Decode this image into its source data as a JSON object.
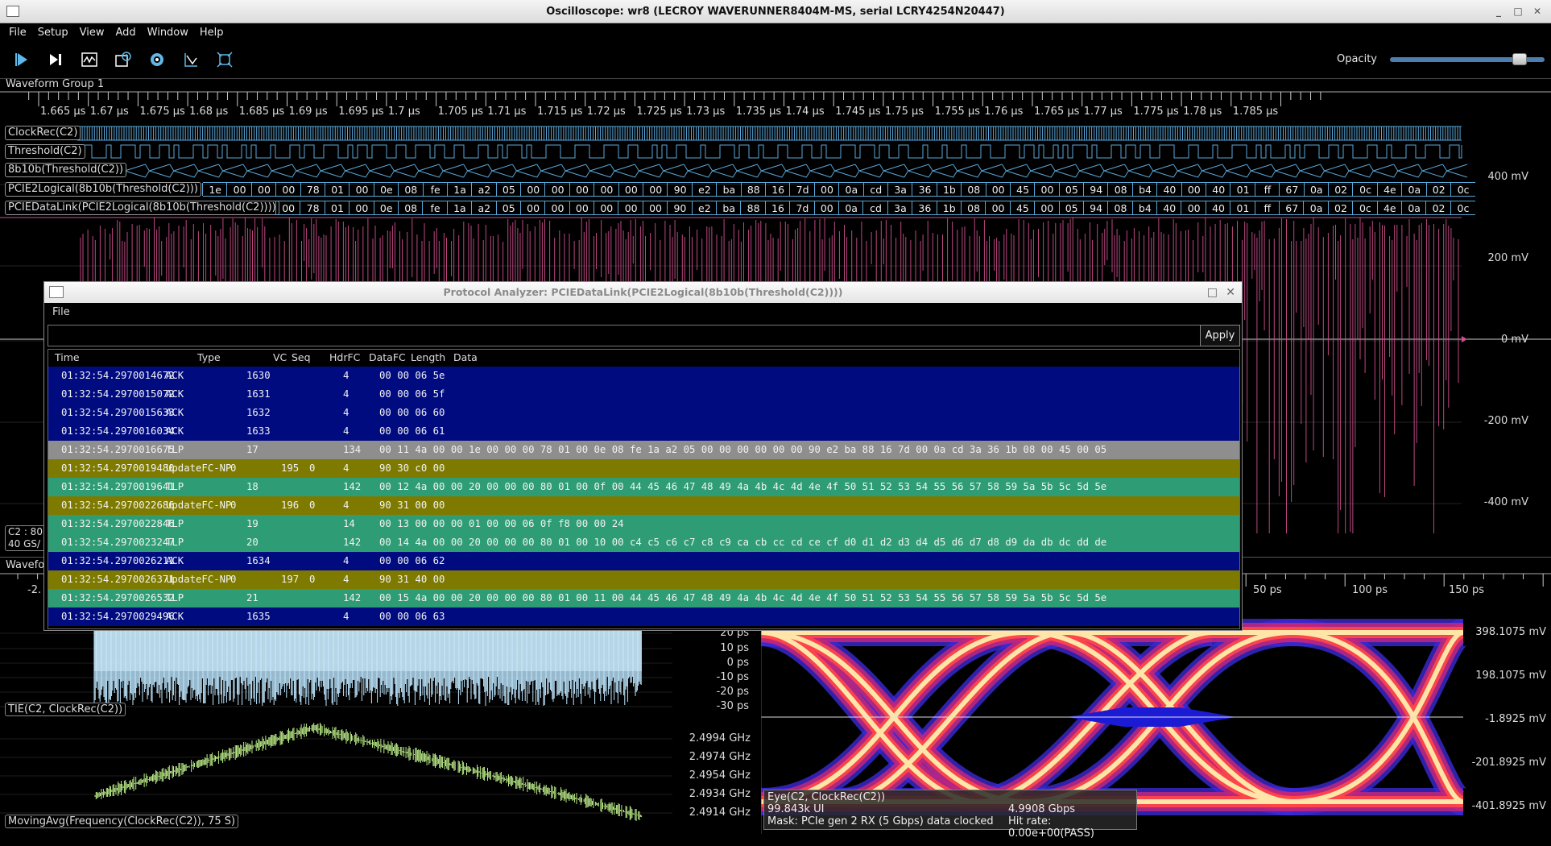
{
  "window": {
    "title": "Oscilloscope: wr8 (LECROY WAVERUNNER8404M-MS, serial LCRY4254N20447)",
    "controls": [
      "_",
      "□",
      "✕"
    ]
  },
  "menu": [
    "File",
    "Setup",
    "View",
    "Add",
    "Window",
    "Help"
  ],
  "toolbar": {
    "buttons": [
      "play-icon",
      "step-icon",
      "waveform-icon",
      "trigger-icon",
      "settings-icon",
      "measure-icon",
      "zoom-fit-icon"
    ],
    "opacity_label": "Opacity",
    "opacity_value": 0.84
  },
  "group1": {
    "label": "Waveform Group 1",
    "time_ticks": [
      "1.665 µs",
      "1.67 µs",
      "1.675 µs",
      "1.68 µs",
      "1.685 µs",
      "1.69 µs",
      "1.695 µs",
      "1.7 µs",
      "1.705 µs",
      "1.71 µs",
      "1.715 µs",
      "1.72 µs",
      "1.725 µs",
      "1.73 µs",
      "1.735 µs",
      "1.74 µs",
      "1.745 µs",
      "1.75 µs",
      "1.755 µs",
      "1.76 µs",
      "1.765 µs",
      "1.77 µs",
      "1.775 µs",
      "1.78 µs",
      "1.785 µs"
    ],
    "traces": [
      "ClockRec(C2)",
      "Threshold(C2)",
      "8b10b(Threshold(C2))",
      "PCIE2Logical(8b10b(Threshold(C2)))",
      "PCIEDataLink(PCIE2Logical(8b10b(Threshold(C2))))"
    ],
    "logical_bytes": [
      "1e",
      "00",
      "00",
      "00",
      "78",
      "01",
      "00",
      "0e",
      "08",
      "fe",
      "1a",
      "a2",
      "05",
      "00",
      "00",
      "00",
      "00",
      "00",
      "00",
      "90",
      "e2",
      "ba",
      "88",
      "16",
      "7d",
      "00",
      "0a",
      "cd",
      "3a",
      "36",
      "1b",
      "08",
      "00",
      "45",
      "00",
      "05",
      "94",
      "08",
      "b4",
      "40",
      "00",
      "40",
      "01",
      "ff",
      "67",
      "0a",
      "02",
      "0c",
      "4e",
      "0a",
      "02",
      "0c"
    ],
    "datalink_bytes": [
      "00",
      "78",
      "01",
      "00",
      "0e",
      "08",
      "fe",
      "1a",
      "a2",
      "05",
      "00",
      "00",
      "00",
      "00",
      "00",
      "00",
      "90",
      "e2",
      "ba",
      "88",
      "16",
      "7d",
      "00",
      "0a",
      "cd",
      "3a",
      "36",
      "1b",
      "08",
      "00",
      "45",
      "00",
      "05",
      "94",
      "08",
      "b4",
      "40",
      "00",
      "40",
      "01",
      "ff",
      "67",
      "0a",
      "02",
      "0c",
      "4e",
      "0a",
      "02",
      "0c"
    ],
    "volt_labels": [
      "400 mV",
      "200 mV",
      "0 mV",
      "-200 mV",
      "-400 mV"
    ],
    "channel_info": [
      "C2 : 80",
      "40 GS/"
    ]
  },
  "group2": {
    "label": "Wavefo",
    "eye_ticks_left": [
      "-2."
    ],
    "eye_ticks": [
      "50 ps",
      "100 ps",
      "150 ps"
    ],
    "tie_label": "TIE(C2, ClockRec(C2))",
    "tie_y": [
      "20 ps",
      "10 ps",
      "0 ps",
      "-10 ps",
      "-20 ps",
      "-30 ps"
    ],
    "freq_label": "MovingAvg(Frequency(ClockRec(C2)), 75 S)",
    "freq_y": [
      "2.4994 GHz",
      "2.4974 GHz",
      "2.4954 GHz",
      "2.4934 GHz",
      "2.4914 GHz"
    ],
    "eye_y": [
      "398.1075 mV",
      "198.1075 mV",
      "-1.8925 mV",
      "-201.8925 mV",
      "-401.8925 mV"
    ],
    "eye_info": {
      "name": "Eye(C2, ClockRec(C2))",
      "ui": "99.843k UI",
      "mask": "Mask: PCIe gen 2 RX (5 Gbps) data clocked",
      "rate": "4.9908 Gbps",
      "hit": "Hit rate: 0.00e+00(PASS)"
    }
  },
  "analyzer": {
    "title": "Protocol Analyzer: PCIEDataLink(PCIE2Logical(8b10b(Threshold(C2))))",
    "menu": "File",
    "filter_value": "",
    "apply_label": "Apply",
    "columns": [
      "Time",
      "Type",
      "VC",
      "Seq",
      "HdrFC",
      "DataFC",
      "Length",
      "Data"
    ],
    "rows": [
      {
        "time": "01:32:54.2970014672",
        "type": "ACK",
        "vc": "",
        "seq": "1630",
        "hdrfc": "",
        "datafc": "",
        "length": "4",
        "data": "00 00 06 5e",
        "kind": "ack"
      },
      {
        "time": "01:32:54.2970015072",
        "type": "ACK",
        "vc": "",
        "seq": "1631",
        "hdrfc": "",
        "datafc": "",
        "length": "4",
        "data": "00 00 06 5f",
        "kind": "ack"
      },
      {
        "time": "01:32:54.2970015633",
        "type": "ACK",
        "vc": "",
        "seq": "1632",
        "hdrfc": "",
        "datafc": "",
        "length": "4",
        "data": "00 00 06 60",
        "kind": "ack"
      },
      {
        "time": "01:32:54.2970016034",
        "type": "ACK",
        "vc": "",
        "seq": "1633",
        "hdrfc": "",
        "datafc": "",
        "length": "4",
        "data": "00 00 06 61",
        "kind": "ack"
      },
      {
        "time": "01:32:54.2970016675",
        "type": "TLP",
        "vc": "",
        "seq": "17",
        "hdrfc": "",
        "datafc": "",
        "length": "134",
        "data": "00 11 4a 00 00 1e 00 00 00 78 01 00 0e 08 fe 1a a2 05 00 00 00 00 00 00 90 e2 ba 88 16 7d 00 0a cd 3a 36 1b 08 00 45 00 05",
        "kind": "sel"
      },
      {
        "time": "01:32:54.2970019480",
        "type": "UpdateFC-NP",
        "vc": "0",
        "seq": "",
        "hdrfc": "195",
        "datafc": "0",
        "length": "4",
        "data": "90 30 c0 00",
        "kind": "upd"
      },
      {
        "time": "01:32:54.2970019641",
        "type": "TLP",
        "vc": "",
        "seq": "18",
        "hdrfc": "",
        "datafc": "",
        "length": "142",
        "data": "00 12 4a 00 00 20 00 00 00 80 01 00 0f 00 44 45 46 47 48 49 4a 4b 4c 4d 4e 4f 50 51 52 53 54 55 56 57 58 59 5a 5b 5c 5d 5e",
        "kind": "tlp"
      },
      {
        "time": "01:32:54.2970022686",
        "type": "UpdateFC-NP",
        "vc": "0",
        "seq": "",
        "hdrfc": "196",
        "datafc": "0",
        "length": "4",
        "data": "90 31 00 00",
        "kind": "upd"
      },
      {
        "time": "01:32:54.2970022846",
        "type": "TLP",
        "vc": "",
        "seq": "19",
        "hdrfc": "",
        "datafc": "",
        "length": "14",
        "data": "00 13 00 00 00 01 00 00 06 0f f8 00 00 24",
        "kind": "tlp"
      },
      {
        "time": "01:32:54.2970023247",
        "type": "TLP",
        "vc": "",
        "seq": "20",
        "hdrfc": "",
        "datafc": "",
        "length": "142",
        "data": "00 14 4a 00 00 20 00 00 00 80 01 00 10 00 c4 c5 c6 c7 c8 c9 ca cb cc cd ce cf d0 d1 d2 d3 d4 d5 d6 d7 d8 d9 da db dc dd de",
        "kind": "tlp"
      },
      {
        "time": "01:32:54.2970026211",
        "type": "ACK",
        "vc": "",
        "seq": "1634",
        "hdrfc": "",
        "datafc": "",
        "length": "4",
        "data": "00 00 06 62",
        "kind": "ack"
      },
      {
        "time": "01:32:54.2970026371",
        "type": "UpdateFC-NP",
        "vc": "0",
        "seq": "",
        "hdrfc": "197",
        "datafc": "0",
        "length": "4",
        "data": "90 31 40 00",
        "kind": "upd"
      },
      {
        "time": "01:32:54.2970026532",
        "type": "TLP",
        "vc": "",
        "seq": "21",
        "hdrfc": "",
        "datafc": "",
        "length": "142",
        "data": "00 15 4a 00 00 20 00 00 00 80 01 00 11 00 44 45 46 47 48 49 4a 4b 4c 4d 4e 4f 50 51 52 53 54 55 56 57 58 59 5a 5b 5c 5d 5e",
        "kind": "tlp"
      },
      {
        "time": "01:32:54.2970029496",
        "type": "ACK",
        "vc": "",
        "seq": "1635",
        "hdrfc": "",
        "datafc": "",
        "length": "4",
        "data": "00 00 06 63",
        "kind": "ack"
      }
    ]
  }
}
